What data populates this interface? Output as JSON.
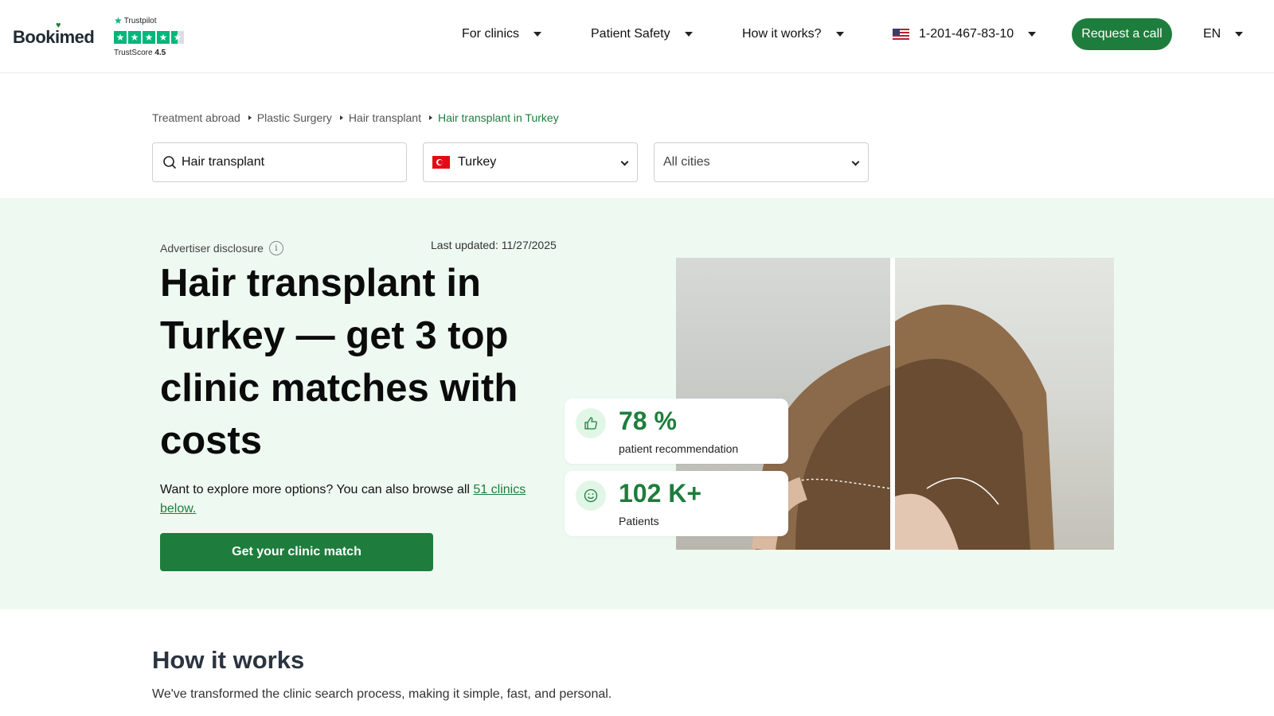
{
  "header": {
    "logo": "Bookimed",
    "trustpilot": {
      "brand": "Trustpilot",
      "score_label": "TrustScore",
      "score": "4.5",
      "stars": 4.5
    },
    "nav": {
      "for_clinics": "For clinics",
      "patient_safety": "Patient Safety",
      "how_it_works": "How it works?",
      "phone": "1-201-467-83-10",
      "language": "EN"
    },
    "request_call": "Request a call"
  },
  "breadcrumb": [
    "Treatment abroad",
    "Plastic Surgery",
    "Hair transplant",
    "Hair transplant in Turkey"
  ],
  "search": {
    "query": "Hair transplant",
    "country": "Turkey",
    "city": "All cities"
  },
  "hero": {
    "disclosure": "Advertiser disclosure",
    "last_updated": "Last updated: 11/27/2025",
    "title": "Hair transplant in Turkey — get 3 top clinic matches with costs",
    "subtitle_text": "Want to explore more options? You can also browse all ",
    "subtitle_link": "51 clinics below.",
    "cta": "Get your clinic match"
  },
  "stats": [
    {
      "icon": "thumbs-up-icon",
      "value": "78 %",
      "label": "patient recommendation"
    },
    {
      "icon": "smile-icon",
      "value": "102 K+",
      "label": "Patients"
    }
  ],
  "how_it_works": {
    "title": "How it works",
    "subtitle": "We've transformed the clinic search process, making it simple, fast, and personal."
  },
  "colors": {
    "brand_green": "#1e7d3c",
    "hero_bg": "#eefaf1",
    "trustpilot_green": "#00b67a"
  }
}
